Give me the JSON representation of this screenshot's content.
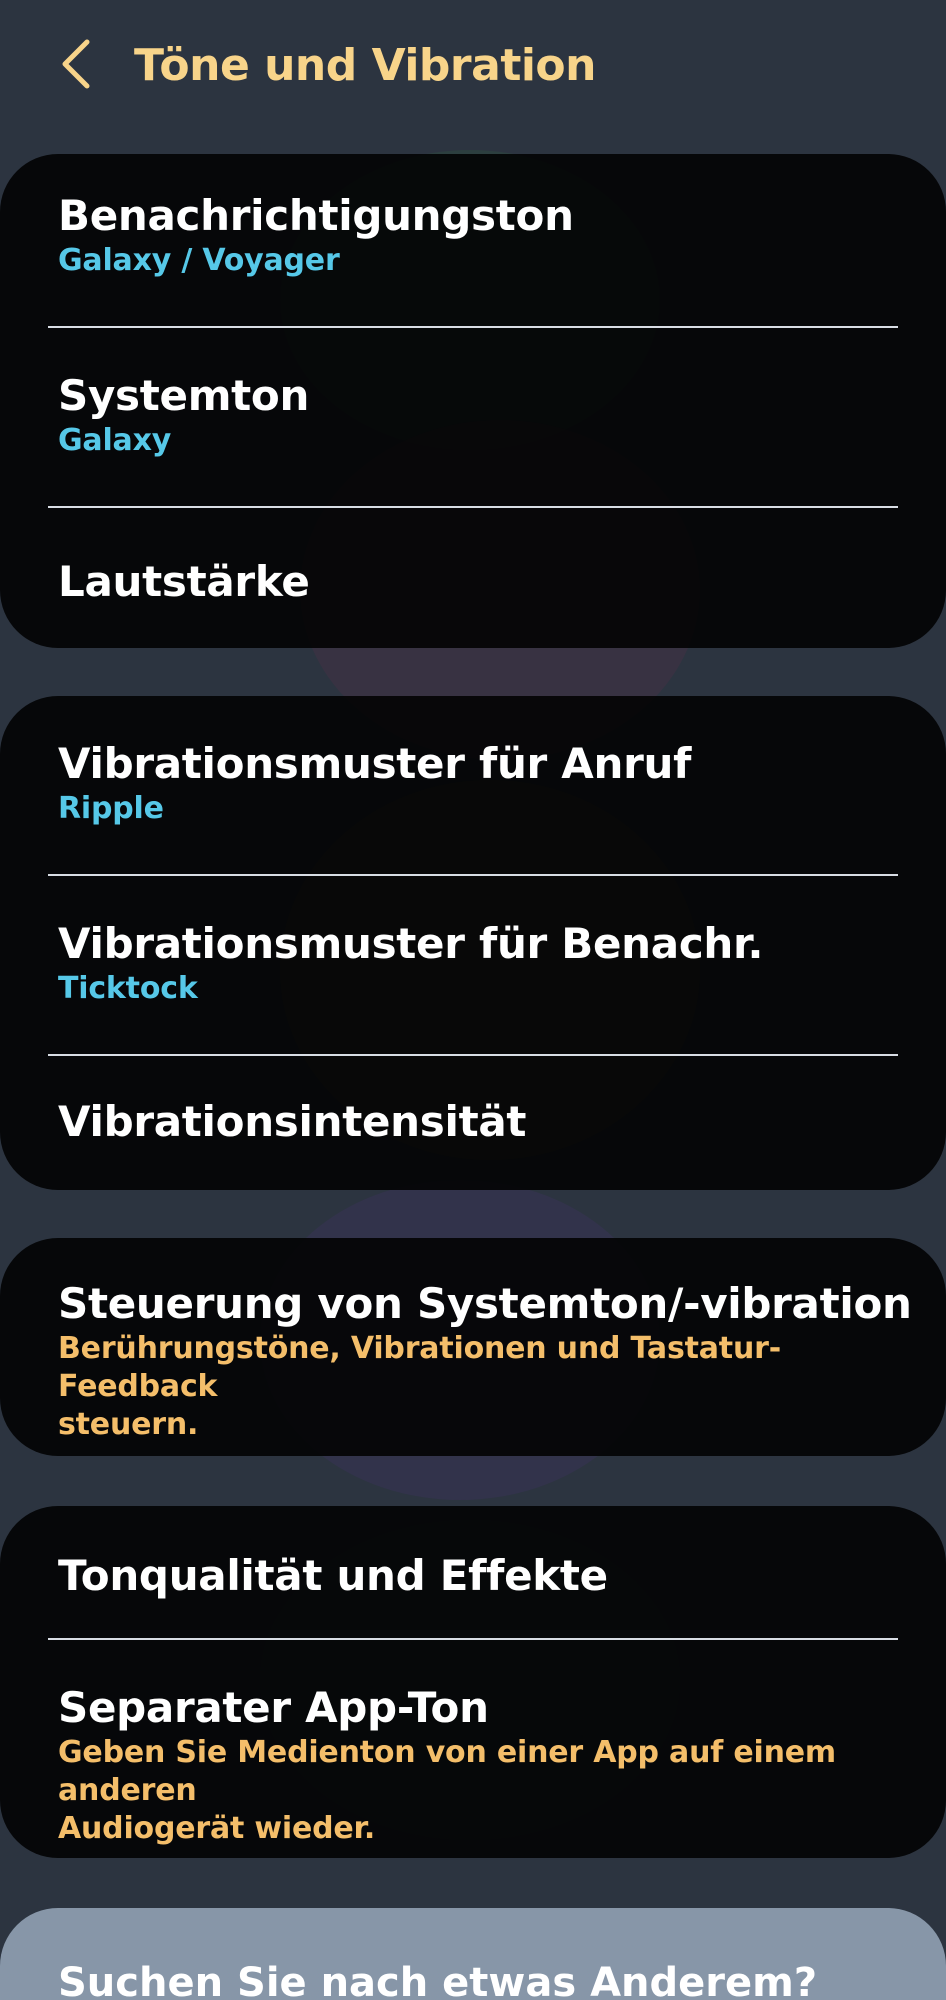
{
  "colors": {
    "background": "#2c3440",
    "accent_title": "#f8d48a",
    "subtitle_blue": "#56c8e8",
    "subtitle_orange": "#f4be6a",
    "card": "#000000",
    "search_card": "#8796a8"
  },
  "header": {
    "back_icon": "chevron-left-icon",
    "title": "Töne und Vibration"
  },
  "groups": [
    {
      "items": [
        {
          "title": "Benachrichtigungston",
          "subtitle": "Galaxy / Voyager"
        },
        {
          "title": "Systemton",
          "subtitle": "Galaxy"
        },
        {
          "title": "Lautstärke",
          "subtitle": ""
        }
      ]
    },
    {
      "items": [
        {
          "title": "Vibrationsmuster für Anruf",
          "subtitle": "Ripple"
        },
        {
          "title": "Vibrationsmuster für Benachr.",
          "subtitle": "Ticktock"
        },
        {
          "title": "Vibrationsintensität",
          "subtitle": ""
        }
      ]
    },
    {
      "items": [
        {
          "title": "Steuerung von Systemton/-vibration",
          "subtitle_line1": "Berührungstöne, Vibrationen und Tastatur-Feedback",
          "subtitle_line2": "steuern."
        }
      ]
    },
    {
      "items": [
        {
          "title": "Tonqualität und Effekte",
          "subtitle": ""
        },
        {
          "title": "Separater App-Ton",
          "subtitle_line1": "Geben Sie Medienton von einer App auf einem anderen",
          "subtitle_line2": "Audiogerät wieder."
        }
      ]
    }
  ],
  "search_prompt": "Suchen Sie nach etwas Anderem?"
}
